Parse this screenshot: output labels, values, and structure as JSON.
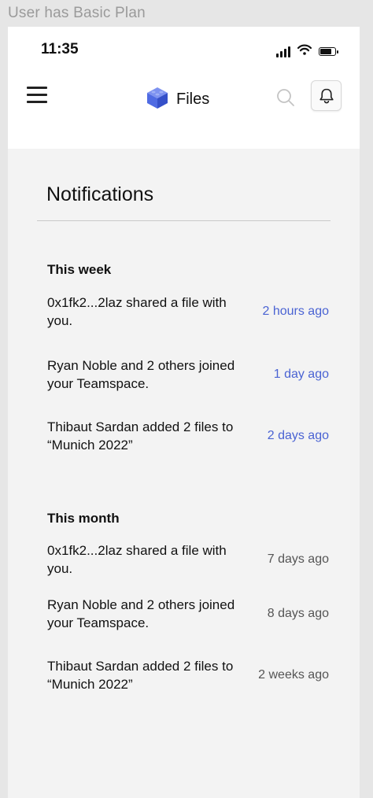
{
  "frame_label": "User has Basic Plan",
  "status_bar": {
    "time": "11:35"
  },
  "header": {
    "title": "Files"
  },
  "page_title": "Notifications",
  "colors": {
    "recent_time": "#4a63d3",
    "older_time": "#555555",
    "brand_icon": "#4f6be3"
  },
  "icons": [
    "menu-icon",
    "cube-logo-icon",
    "search-icon",
    "bell-icon",
    "signal-icon",
    "wifi-icon",
    "battery-icon"
  ],
  "sections": [
    {
      "heading": "This week",
      "items": [
        {
          "text": "0x1fk2...2laz shared a file with you.",
          "time": "2 hours ago"
        },
        {
          "text": "Ryan Noble and 2 others joined your Teamspace.",
          "time": "1 day ago"
        },
        {
          "text": "Thibaut Sardan added 2 files to “Munich 2022”",
          "time": "2 days ago"
        }
      ]
    },
    {
      "heading": "This month",
      "items": [
        {
          "text": "0x1fk2...2laz shared a file with you.",
          "time": "7 days ago"
        },
        {
          "text": "Ryan Noble and 2 others joined your Teamspace.",
          "time": "8 days ago"
        },
        {
          "text": "Thibaut Sardan added 2 files to “Munich 2022”",
          "time": "2 weeks ago"
        }
      ]
    }
  ]
}
